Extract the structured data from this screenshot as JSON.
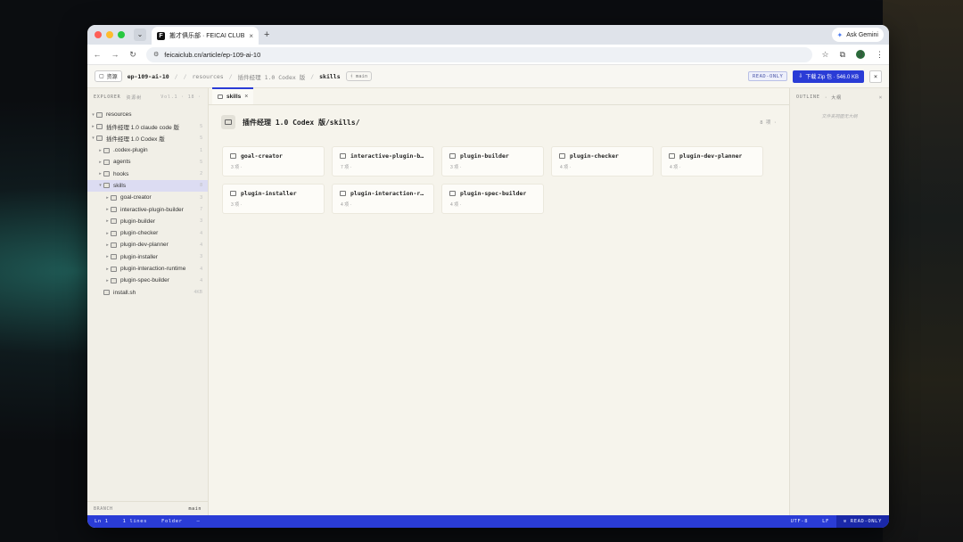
{
  "browser": {
    "tab_title": "搬才俱乐部 · FEICAI CLUB",
    "favicon": "F",
    "tab_close": "×",
    "new_tab": "+",
    "tab_search": "⌄",
    "ask_gemini": "Ask Gemini",
    "url": "feicaiclub.cn/article/ep-109-ai-10",
    "avatar": "J"
  },
  "app": {
    "back_label": "资源",
    "breadcrumbs": [
      "ep-109-ai-10",
      "resources",
      "插件经理 1.0 Codex 版",
      "skills"
    ],
    "branch": "main",
    "readonly_badge": "READ-ONLY",
    "zip_button": "下载 Zip 包 · 546.0 KB",
    "close_label": "×"
  },
  "sidebar": {
    "title": "EXPLORER",
    "subtitle": "资源树",
    "meta": "Vol.1 · 18 ·",
    "items": [
      {
        "label": "resources",
        "caret": "▾",
        "count": ""
      },
      {
        "label": "插件经理 1.0 claude code 版",
        "caret": "▸",
        "count": "5"
      },
      {
        "label": "插件经理 1.0 Codex 版",
        "caret": "▾",
        "count": "5"
      },
      {
        "label": ".codex-plugin",
        "caret": "▸",
        "count": "1"
      },
      {
        "label": "agents",
        "caret": "▸",
        "count": "5"
      },
      {
        "label": "hooks",
        "caret": "▸",
        "count": "2"
      },
      {
        "label": "skills",
        "caret": "▾",
        "count": "8"
      },
      {
        "label": "goal-creator",
        "caret": "▸",
        "count": "3"
      },
      {
        "label": "interactive-plugin-builder",
        "caret": "▸",
        "count": "7"
      },
      {
        "label": "plugin-builder",
        "caret": "▸",
        "count": "3"
      },
      {
        "label": "plugin-checker",
        "caret": "▸",
        "count": "4"
      },
      {
        "label": "plugin-dev-planner",
        "caret": "▸",
        "count": "4"
      },
      {
        "label": "plugin-installer",
        "caret": "▸",
        "count": "3"
      },
      {
        "label": "plugin-interaction-runtime",
        "caret": "▸",
        "count": "4"
      },
      {
        "label": "plugin-spec-builder",
        "caret": "▸",
        "count": "4"
      },
      {
        "label": "install.sh",
        "caret": "",
        "count": "4KB"
      }
    ],
    "footer_label": "BRANCH",
    "footer_value": "main"
  },
  "editor": {
    "tab_label": "skills",
    "tab_close": "×",
    "dir_title": "插件经理 1.0 Codex 版/skills/",
    "dir_count": "8 项 ·",
    "cards": [
      {
        "name": "goal-creator",
        "meta": "3 项 ·"
      },
      {
        "name": "interactive-plugin-builder",
        "meta": "7 项 ·"
      },
      {
        "name": "plugin-builder",
        "meta": "3 项 ·"
      },
      {
        "name": "plugin-checker",
        "meta": "4 项 ·"
      },
      {
        "name": "plugin-dev-planner",
        "meta": "4 项 ·"
      },
      {
        "name": "plugin-installer",
        "meta": "3 项 ·"
      },
      {
        "name": "plugin-interaction-runtime",
        "meta": "4 项 ·"
      },
      {
        "name": "plugin-spec-builder",
        "meta": "4 项 ·"
      }
    ]
  },
  "outline": {
    "title": "OUTLINE",
    "subtitle": "· 大纲",
    "close": "×",
    "empty_text": "文件夹视图无大纲"
  },
  "status": {
    "position": "Ln 1",
    "lines": "1 lines",
    "mode": "Folder",
    "dash": "—",
    "encoding": "UTF-8",
    "eol": "LF",
    "readonly": "READ-ONLY"
  },
  "colors": {
    "accent": "#2a3cd6",
    "selected_row": "#dcdcf2",
    "panel_bg": "#f1efe7"
  }
}
